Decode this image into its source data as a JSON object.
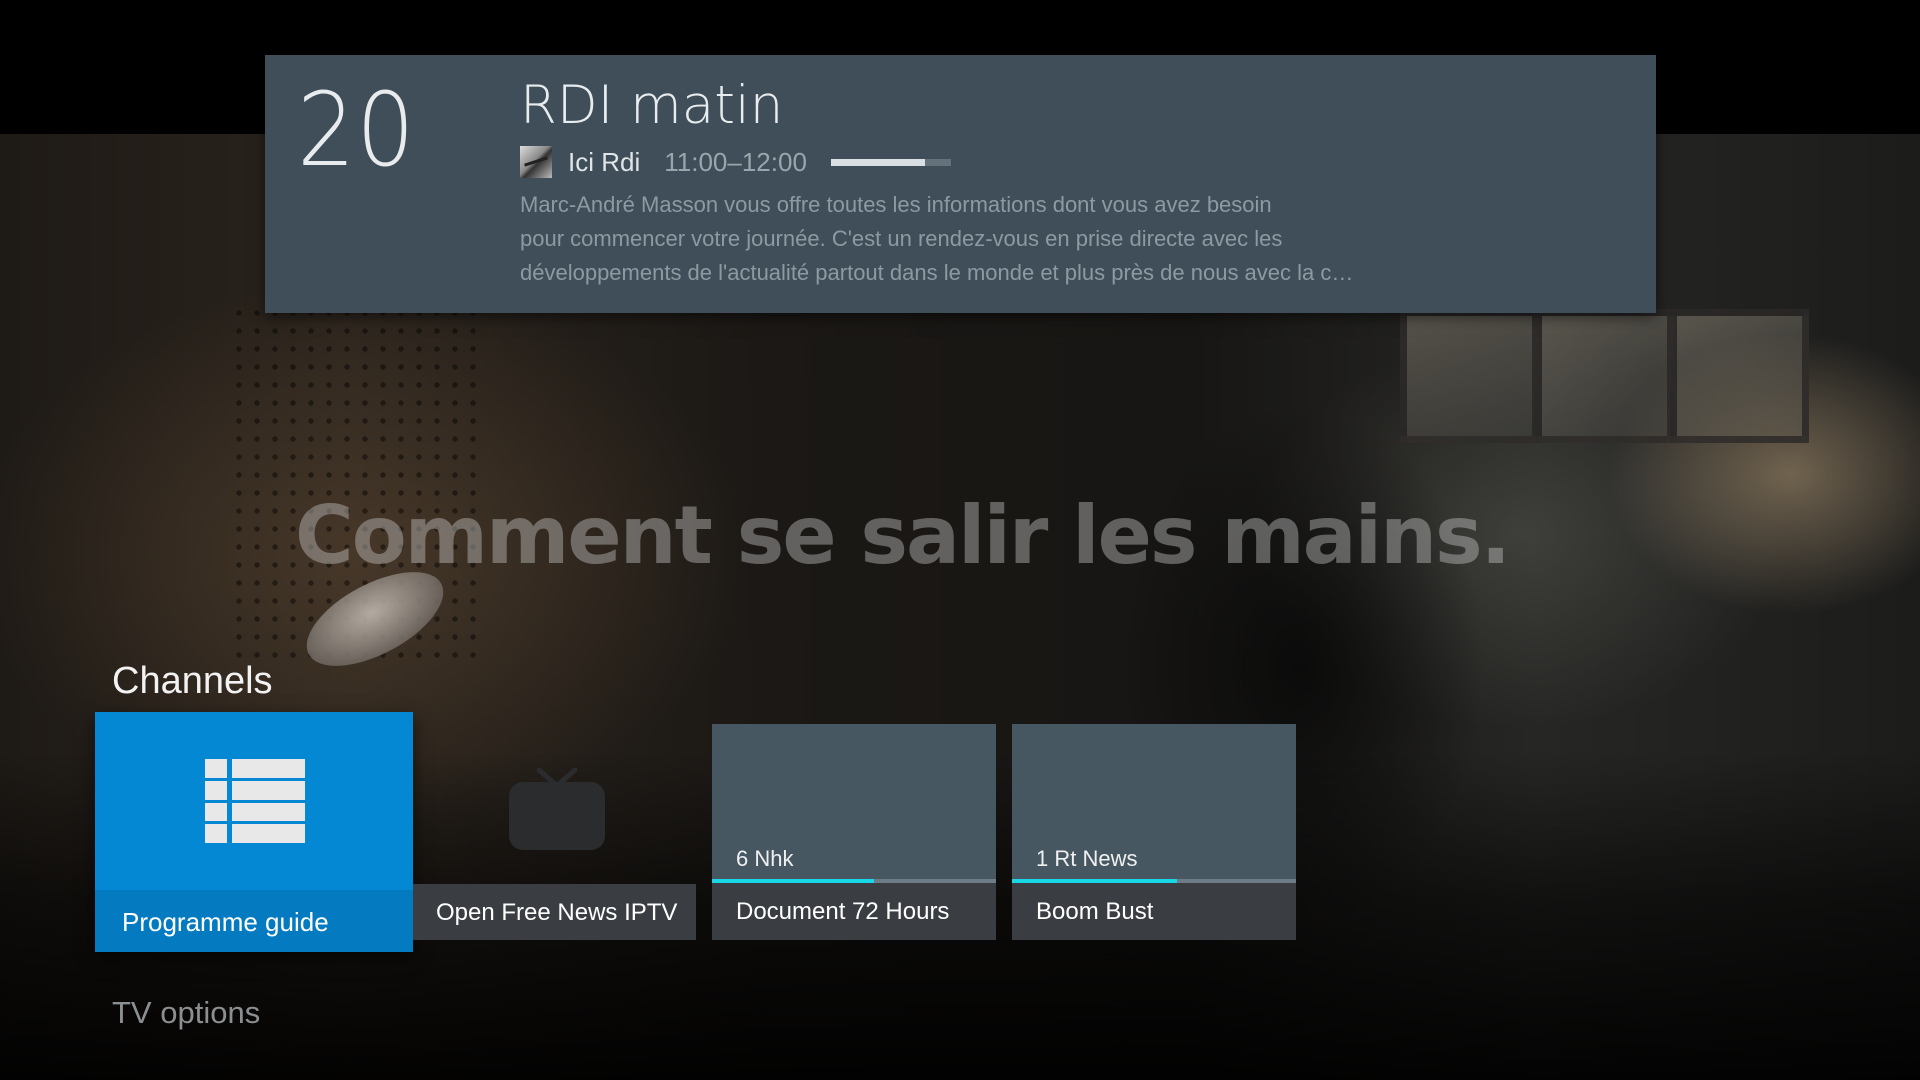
{
  "background": {
    "watermark_text": "Comment se salir les mains."
  },
  "now_playing": {
    "channel_number": "20",
    "program_title": "RDI matin",
    "channel_name": "Ici Rdi",
    "time_range": "11:00–12:00",
    "progress_fraction": 0.78,
    "description_lines": [
      "Marc-André Masson vous offre toutes les informations dont vous avez besoin",
      "pour commencer votre journée. C'est un rendez-vous en prise directe avec les",
      "développements de l'actualité partout dans le monde et plus près de nous avec la c…"
    ]
  },
  "channels": {
    "title": "Channels",
    "tiles": [
      {
        "label": "Programme guide",
        "icon": "list-icon"
      },
      {
        "label": "Open Free News IPTV",
        "icon": "tv-icon"
      },
      {
        "label": "Document 72 Hours",
        "channel": "6 Nhk",
        "progress_fraction": 0.57
      },
      {
        "label": "Boom Bust",
        "channel": "1 Rt News",
        "progress_fraction": 0.58
      }
    ]
  },
  "tv_options": {
    "title": "TV options"
  },
  "colors": {
    "accent_blue": "#0488d3",
    "progress_cyan": "#18d7e6",
    "card_bg": "#3f4e58"
  }
}
